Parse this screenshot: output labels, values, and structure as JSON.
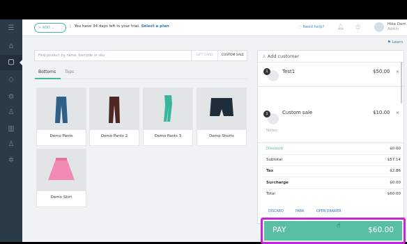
{
  "header": {
    "add_label": "+ ADD ⌄",
    "trial_text": "You have 34 days left in your trial.",
    "plan_link": "Select a plan",
    "need_help": "Need help?",
    "user_name": "Hike Dem",
    "user_role": "Admin"
  },
  "learn_link": "Learn",
  "search": {
    "placeholder": "Find product by name, barcode or sku",
    "gift_card": "GIFT CARD",
    "custom_sale": "CUSTOM SALE"
  },
  "tabs": [
    {
      "label": "Bottoms",
      "active": true
    },
    {
      "label": "Tops",
      "active": false
    }
  ],
  "products": [
    {
      "name": "Demo Pants",
      "icon": "navy-pants-icon",
      "color": "#2f5f84"
    },
    {
      "name": "Demo Pants 2",
      "icon": "brown-pants-icon",
      "color": "#4e2723"
    },
    {
      "name": "Demo Pants 3",
      "icon": "green-pants-icon",
      "color": "#36b69a"
    },
    {
      "name": "Demo Shorts",
      "icon": "shorts-icon",
      "color": "#1f2c3a"
    },
    {
      "name": "Demo Skirt",
      "icon": "skirt-icon",
      "color": "#f18ab4"
    }
  ],
  "cart": {
    "add_customer": "Add customer",
    "items": [
      {
        "qty": "1",
        "name": "Test1",
        "price": "$50.00"
      },
      {
        "qty": "1",
        "name": "Custom sale",
        "price": "$10.00"
      }
    ],
    "notes": "Notes",
    "summary": [
      {
        "label": "Discount",
        "value": "$0.00"
      },
      {
        "label": "Subtotal",
        "value": "$57.14"
      },
      {
        "label": "Tax",
        "value": "$2.86"
      },
      {
        "label": "Surcharge",
        "value": "$0.00"
      },
      {
        "label": "Total",
        "value": "$60.00"
      }
    ],
    "actions": [
      "DISCARD",
      "PARK",
      "OPEN DRAWER"
    ],
    "pay_label": "PAY",
    "pay_amount": "$60.00"
  },
  "colors": {
    "accent": "#43b89d",
    "pay": "#59bfa4",
    "highlight": "#c626d9",
    "sidebar": "#2b3a47"
  }
}
